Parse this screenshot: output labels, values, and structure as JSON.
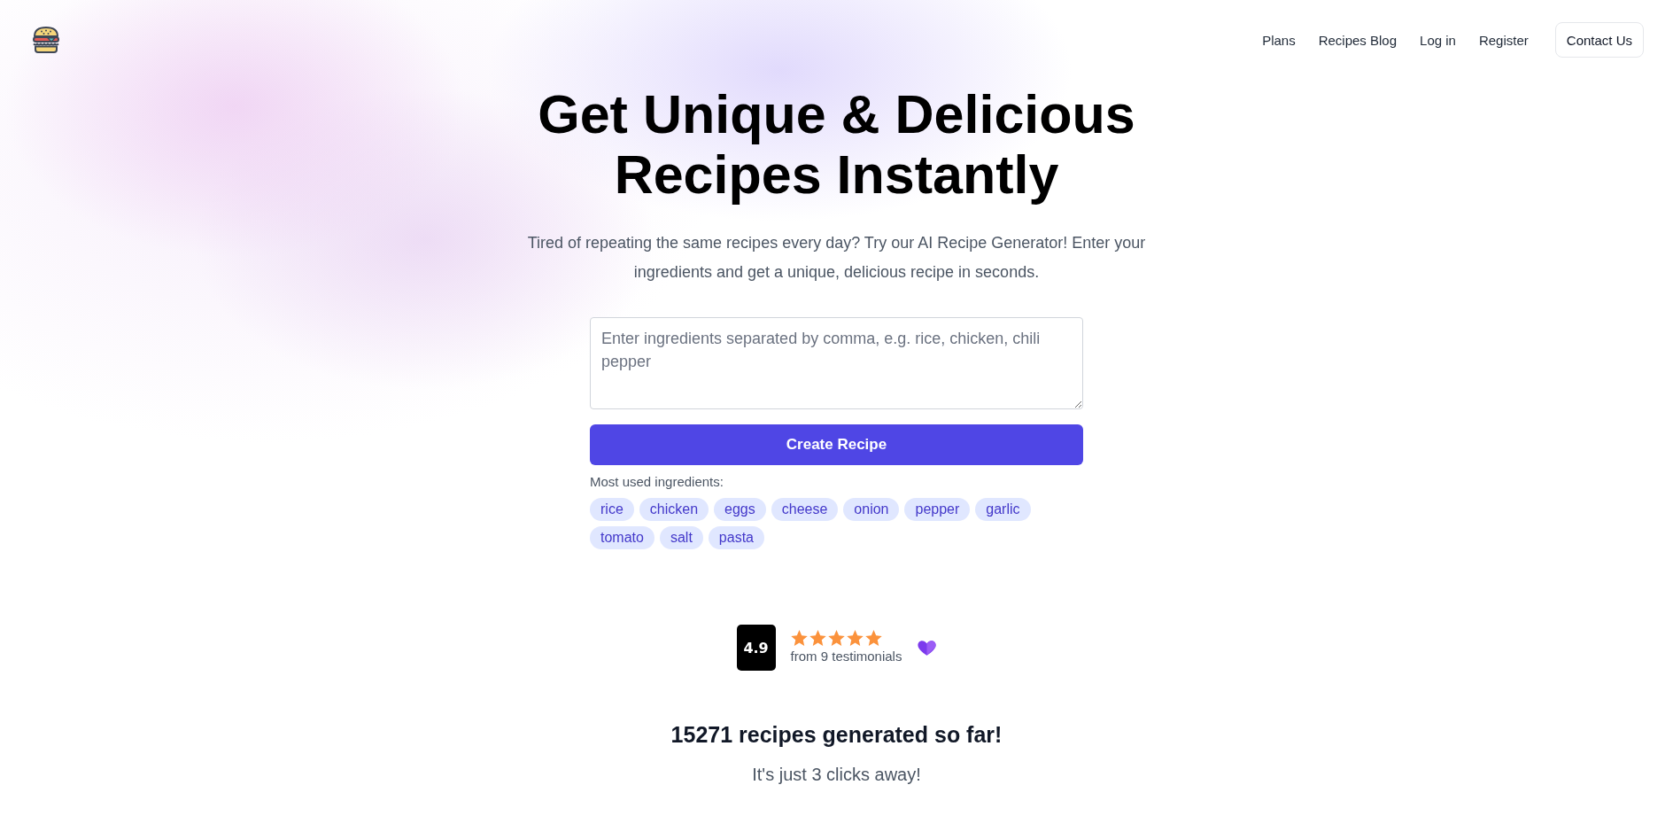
{
  "header": {
    "nav_links": [
      "Plans",
      "Recipes Blog",
      "Log in",
      "Register"
    ],
    "contact_button": "Contact Us"
  },
  "hero": {
    "title": "Get Unique & Delicious Recipes Instantly",
    "subtitle": "Tired of repeating the same recipes every day? Try our AI Recipe Generator! Enter your ingredients and get a unique, delicious recipe in seconds."
  },
  "form": {
    "ingredients_field": {
      "placeholder": "Enter ingredients separated by comma, e.g. rice, chicken, chili pepper"
    },
    "submit_button": "Create Recipe",
    "suggestions_label": "Most used ingredients:",
    "ingredient_tags": [
      "rice",
      "chicken",
      "eggs",
      "cheese",
      "onion",
      "pepper",
      "garlic",
      "tomato",
      "salt",
      "pasta"
    ]
  },
  "rating": {
    "score": "4.9",
    "stars": 5,
    "caption": "from 9 testimonials"
  },
  "stats": {
    "headline": "15271 recipes generated so far!",
    "tagline": "It's just 3 clicks away!"
  }
}
